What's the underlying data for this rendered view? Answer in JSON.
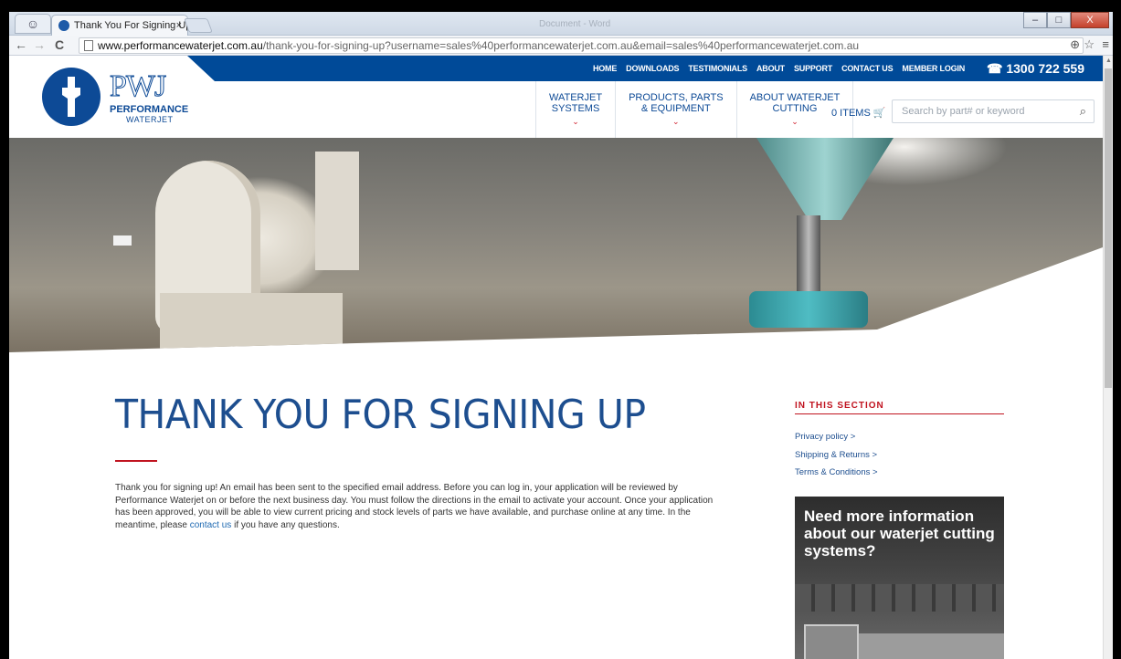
{
  "browser": {
    "tab_title": "Thank You For Signing Up",
    "tab_close": "×",
    "ghost_title": "Document - Word",
    "url_host": "www.performancewaterjet.com.au",
    "url_path": "/thank-you-for-signing-up?username=sales%40performancewaterjet.com.au&email=sales%40performancewaterjet.com.au",
    "nav": {
      "back": "←",
      "forward": "→",
      "reload": "C"
    },
    "omni_right": {
      "zoom": "⊕",
      "star": "☆",
      "menu": "≡"
    },
    "window": {
      "minimize": "–",
      "maximize": "□",
      "close": "X"
    }
  },
  "header": {
    "utility_nav": [
      "HOME",
      "DOWNLOADS",
      "TESTIMONIALS",
      "ABOUT",
      "SUPPORT",
      "CONTACT US",
      "MEMBER LOGIN"
    ],
    "phone": "☎ 1300 722 559",
    "logo": {
      "mark": "PWJ",
      "line1": "PERFORMANCE",
      "line2": "WATERJET"
    },
    "main_nav": [
      {
        "line1": "WATERJET",
        "line2": "SYSTEMS",
        "chevron": "⌄"
      },
      {
        "line1": "PRODUCTS, PARTS",
        "line2": "& EQUIPMENT",
        "chevron": "⌄"
      },
      {
        "line1": "ABOUT WATERJET",
        "line2": "CUTTING",
        "chevron": "⌄"
      }
    ],
    "cart": "0 ITEMS 🛒",
    "search_placeholder": "Search by part# or keyword",
    "search_icon": "⌕"
  },
  "main": {
    "title": "THANK YOU FOR SIGNING UP",
    "body_before_link": "Thank you for signing up! An email has been sent to the specified email address. Before you can log in, your application will be reviewed by Performance Waterjet on or before the next business day. You must follow the directions in the email to activate your account. Once your application has been approved, you will be able to view current pricing and stock levels of parts we have available, and purchase online at any time. In the meantime, please ",
    "body_link": "contact us",
    "body_after_link": " if you have any questions."
  },
  "sidebar": {
    "heading": "IN THIS SECTION",
    "links": [
      "Privacy policy  >",
      "Shipping & Returns  >",
      "Terms & Conditions  >"
    ],
    "promo_text": "Need more information about our waterjet cutting systems?"
  },
  "colors": {
    "brand_blue": "#004a98",
    "accent_red": "#c0131f",
    "link_blue": "#1f6ab2"
  }
}
